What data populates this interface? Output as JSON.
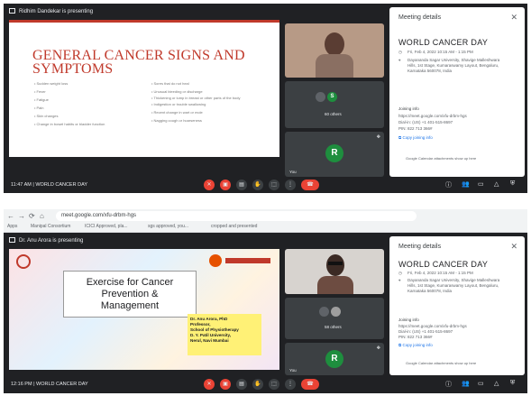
{
  "screens": [
    {
      "presenting_label": "Ridhim Dandekar is presenting",
      "slide": {
        "title_line1": "GENERAL CANCER SIGNS AND",
        "title_line2": "SYMPTOMS",
        "col1": [
          "Sudden weight loss",
          "Fever",
          "Fatigue",
          "Pain",
          "Skin changes",
          "Change in bowel habits or bladder function"
        ],
        "col2": [
          "Sores that do not heal",
          "Unusual bleeding or discharge",
          "Thickening or lump in breast or other parts of the body",
          "Indigestion or trouble swallowing",
          "Recent change in wart or mole",
          "Nagging cough or hoarseness"
        ]
      },
      "others_label": "60 others",
      "you_label": "You",
      "avatar_letter": "R",
      "small_avatar_letter": "S",
      "time": "11:47 AM",
      "meeting_title": "WORLD CANCER DAY"
    },
    {
      "url": "meet.google.com/xfu-drbm-hgs",
      "bookmarks": [
        "Apps",
        "Manipal Consortium",
        "ICICI Approved, pla...",
        "sgs approved, you...",
        "cropped and presented"
      ],
      "presenting_label": "Dr. Anu Arora is presenting",
      "slide": {
        "box_line1": "Exercise for Cancer",
        "box_line2": "Prevention &",
        "box_line3": "Management",
        "speaker_lines": [
          "Dr. Anu Arora, PhD",
          "Professor,",
          "School of Physiotherapy",
          "D. Y. Patil University,",
          "Nerul, Navi Mumbai"
        ]
      },
      "others_label": "58 others",
      "you_label": "You",
      "avatar_letter": "R",
      "time": "12:16 PM",
      "meeting_title": "WORLD CANCER DAY"
    }
  ],
  "meeting_details": {
    "panel_title": "Meeting details",
    "event_name": "WORLD CANCER DAY",
    "date_time": "Fri, Feb 4, 2022 10:15 AM - 1:15 PM",
    "location": "Dayananda Sagar University, Shavige Malleshwara Hills, 1st Stage, Kumaraswamy Layout, Bengaluru, Karnataka 560078, India",
    "joining_info_label": "Joining info",
    "join_link": "https://meet.google.com/xfu-drbm-hgs",
    "dial_in": "Dial-in: (US) +1 401-515-8697",
    "pin": "PIN: 822 713 366#",
    "copy_label": "Copy joining info",
    "calendar_note": "Google Calendar attachments show up here"
  }
}
